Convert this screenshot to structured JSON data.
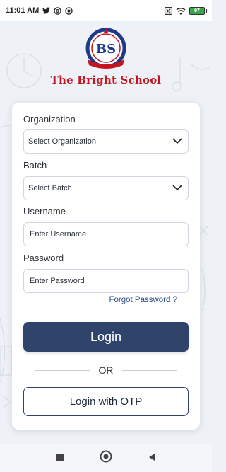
{
  "status_bar": {
    "time": "11:01 AM",
    "left_icons": [
      "twitter-icon",
      "at-sign-icon",
      "app-icon"
    ],
    "right_icons": [
      "x-box-icon",
      "wifi-icon",
      "battery-icon"
    ],
    "battery": "97"
  },
  "branding": {
    "school_name": "The Bright School",
    "emblem_text": "WE WILL FIND A WAY",
    "emblem_initials": "BS",
    "brand_color": "#c3151f"
  },
  "form": {
    "organization_label": "Organization",
    "organization_value": "Select Organization",
    "batch_label": "Batch",
    "batch_value": "Select Batch",
    "username_label": "Username",
    "username_placeholder": "Enter Username",
    "password_label": "Password",
    "password_placeholder": "Enter Password",
    "forgot_password": "Forgot Password ?",
    "login_button": "Login",
    "or_text": "OR",
    "otp_button": "Login with OTP"
  },
  "nav_bar": {
    "icons": [
      "square-icon",
      "circle-home-icon",
      "back-triangle-icon"
    ]
  },
  "colors": {
    "primary": "#2f436b",
    "background": "#eef1f6",
    "link": "#2a4a84"
  }
}
